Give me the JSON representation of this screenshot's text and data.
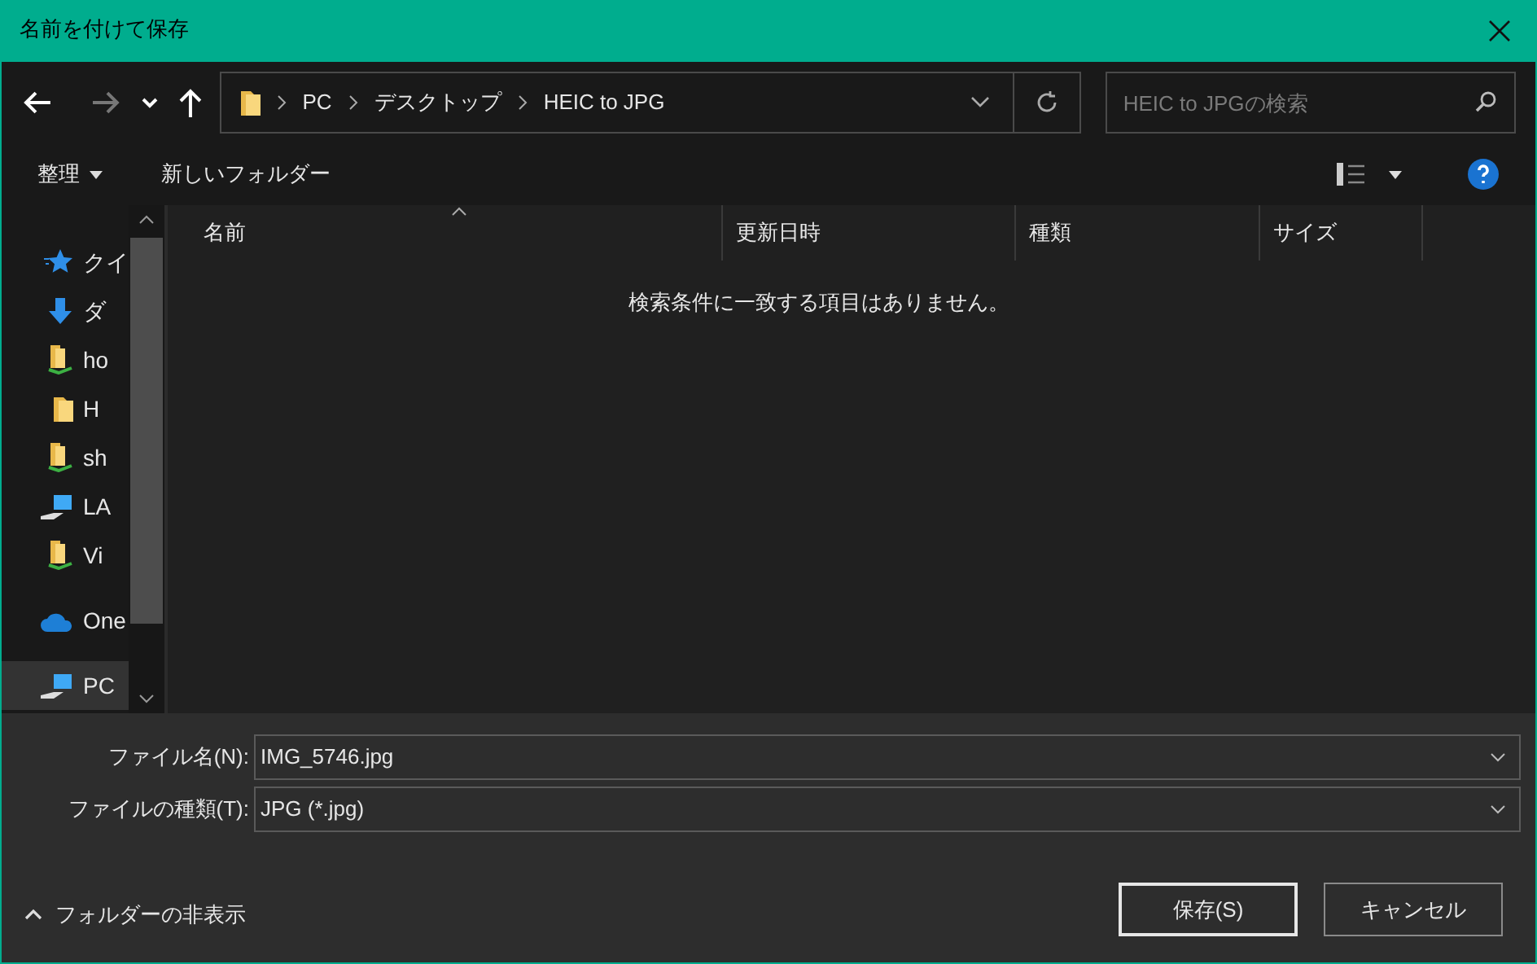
{
  "window": {
    "title": "名前を付けて保存"
  },
  "address": {
    "crumbs": [
      "PC",
      "デスクトップ",
      "HEIC to JPG"
    ]
  },
  "search": {
    "placeholder": "HEIC to JPGの検索"
  },
  "toolbar": {
    "organize": "整理",
    "new_folder": "新しいフォルダー"
  },
  "sidebar": {
    "items": [
      {
        "label": "クイ",
        "kind": "star",
        "selected": false
      },
      {
        "label": "ダ",
        "kind": "download",
        "selected": false
      },
      {
        "label": "ho",
        "kind": "synced-folder",
        "selected": false
      },
      {
        "label": "H",
        "kind": "folder",
        "selected": false
      },
      {
        "label": "sh",
        "kind": "synced-folder",
        "selected": false
      },
      {
        "label": "LA",
        "kind": "computer",
        "selected": false
      },
      {
        "label": "Vi",
        "kind": "synced-folder",
        "selected": false
      },
      {
        "label": "One",
        "kind": "cloud",
        "selected": false
      },
      {
        "label": "PC",
        "kind": "computer",
        "selected": true
      }
    ]
  },
  "table": {
    "columns": [
      "名前",
      "更新日時",
      "種類",
      "サイズ"
    ],
    "empty_message": "検索条件に一致する項目はありません。"
  },
  "fields": [
    {
      "label": "ファイル名(N):",
      "value": "IMG_5746.jpg"
    },
    {
      "label": "ファイルの種類(T):",
      "value": "JPG (*.jpg)"
    }
  ],
  "hide_folders": "フォルダーの非表示",
  "buttons": [
    {
      "label": "保存(S)",
      "default": true
    },
    {
      "label": "キャンセル",
      "default": false
    }
  ]
}
